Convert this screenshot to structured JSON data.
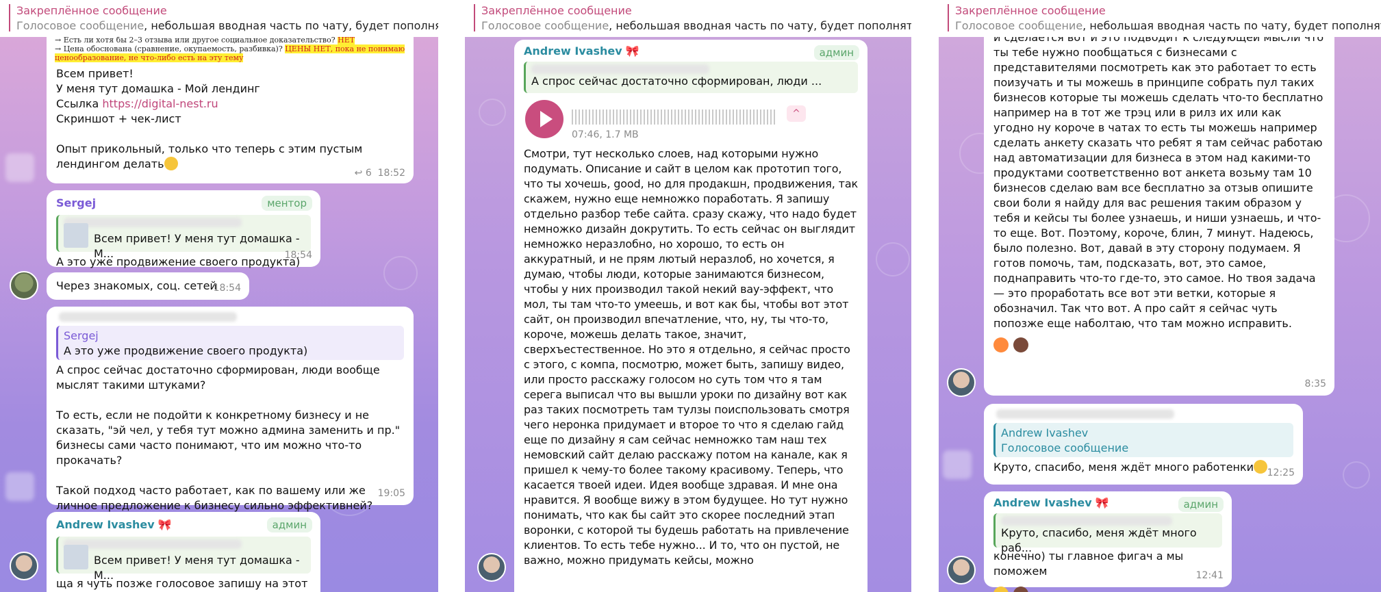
{
  "pinned": {
    "title": "Закреплённое сообщение",
    "prefix": "Голосовое сообщение",
    "text": ", небольшая вводная часть по чату, будет пополнятся"
  },
  "panel1": {
    "msg1": {
      "line1": "→ Есть ли хотя бы 2–3 отзыва или другое социальное доказательство? ",
      "line1_hl": "НЕТ",
      "line2": "→ Цена обоснована (сравнение, окупаемость, разбивка)? ",
      "line2_hl": "ЦЕНЫ НЕТ, пока не понимаю ценообразование, не что-либо есть на эту тему",
      "greet": "Всем привет!",
      "homework": "У меня тут домашка - Мой лендинг",
      "link_label": "Ссылка ",
      "link": "https://digital-nest.ru",
      "screens": "Скриншот + чек-лист",
      "experience": "Опыт прикольный, только что теперь с этим пустым лендингом делать",
      "replies": "6",
      "time": "18:52"
    },
    "msg2": {
      "name": "Sergej",
      "role": "ментор",
      "quote": "Всем привет!  У меня тут домашка - М...",
      "text": "А это уже продвижение своего продукта)",
      "time": "18:54"
    },
    "msg3": {
      "text": "Через знакомых, соц. сетей",
      "time": "18:54"
    },
    "msg4": {
      "quote_name": "Sergej",
      "quote_text": "А это уже продвижение своего продукта)",
      "text": "А спрос сейчас достаточно сформирован, люди вообще мыслят такими штуками?\n\nТо есть, если не подойти к конкретному бизнесу и не сказать, \"эй чел, у тебя тут можно админа заменить и пр.\" бизнесы сами часто понимают, что им можно что-то прокачать?\n\nТакой подход часто работает, как по вашему или же личное предложение к бизнесу сильно эффективней?",
      "time": "19:05"
    },
    "msg5": {
      "name": "Andrew Ivashev",
      "role": "админ",
      "quote": "Всем привет!  У меня тут домашка - М...",
      "text": "ща я чуть позже голосовое запишу на этот счёт"
    }
  },
  "panel2": {
    "name": "Andrew Ivashev",
    "role": "админ",
    "quote": "А спрос сейчас достаточно сформирован, люди ...",
    "voice_meta": "07:46, 1.7 MB",
    "caret": "^",
    "text": "Смотри, тут несколько слоев, над которыми нужно подумать. Описание и сайт в целом как прототип того, что ты хочешь, good, но для продакшн, продвижения, так скажем, нужно еще немножко поработать. Я запишу отдельно разбор тебе сайта. сразу скажу, что надо будет немножко дизайн докрутить. То есть сейчас он выглядит немножко неразлобно, но хорошо, то есть он аккуратный, и не прям лютый неразлоб, но хочется, я думаю, чтобы люди, которые занимаются бизнесом, чтобы у них производил такой некий вау-эффект, что мол, ты там что-то умеешь, и вот как бы, чтобы вот этот сайт, он производил впечатление, что, ну, ты что-то, короче, можешь делать такое, значит, сверхъестественное. Но это я отдельно, я сейчас просто с этого, с компа, посмотрю, может быть, запишу видео, или просто расскажу голосом но суть том что я там серега выписал что вы вышли уроки по дизайну вот как раз таких посмотреть там тулзы поиспользовать смотря чего неронка придумает и второе то что я сделаю гайд еще по дизайну я сам сейчас немножко там наш тех немовский сайт делаю расскажу потом на канале, как я пришел к чему-то более такому красивому. Теперь, что касается твоей идеи. Идея вообще здравая. И мне она нравится. Я вообще вижу в этом будущее. Но тут нужно понимать, что как бы сайт это скорее последний этап воронки, с которой ты будешь работать на привлечение клиентов. То есть тебе нужно... И то, что он пустой, не важно, можно придумать кейсы, можно"
  },
  "panel3": {
    "msg1": {
      "text": "и сделается вот и это подводит к следующей мысли что ты тебе нужно пообщаться с бизнесами с представителями посмотреть как это работает то есть поизучать и ты можешь в принципе собрать пул таких бизнесов которые ты можешь сделать что-то бесплатно например на в тот же трэц или в рилз их или как угодно ну короче в чатах то есть ты можешь например сделать анкету сказать что ребят я там сейчас работаю над автоматизации для бизнеса в этом над какими-то продуктами соответственно вот анкета возьму там 10 бизнесов сделаю вам все бесплатно за отзыв опишите свои боли я найду для вас решения таким образом у тебя и кейсы ты более узнаешь, и ниши узнаешь, и что-то еще. Вот. Поэтому, короче, блин, 7 минут. Надеюсь, было полезно. Вот, давай в эту сторону подумаем. Я готов помочь, там, подсказать, вот, это самое, поднаправить что-то где-то, это самое. Но твоя задача — это проработать все вот эти ветки, которые я обозначил. Так что вот. А про сайт я сейчас чуть попозже еще наболтаю, что там можно исправить.",
      "time": "8:35"
    },
    "msg2": {
      "quote_name": "Andrew Ivashev",
      "quote_text": "Голосовое сообщение",
      "text": "Круто, спасибо, меня ждёт много работенки",
      "time": "12:25"
    },
    "msg3": {
      "name": "Andrew Ivashev",
      "role": "админ",
      "quote": "Круто, спасибо, меня ждёт много раб...",
      "text": "конечно) ты главное фигач а мы поможем",
      "time": "12:41"
    }
  },
  "colors": {
    "accent": "#c24a7a",
    "admin_green": "#5aa56a",
    "sergej_violet": "#7a5ad6",
    "andrew_teal": "#2b8ca0"
  }
}
